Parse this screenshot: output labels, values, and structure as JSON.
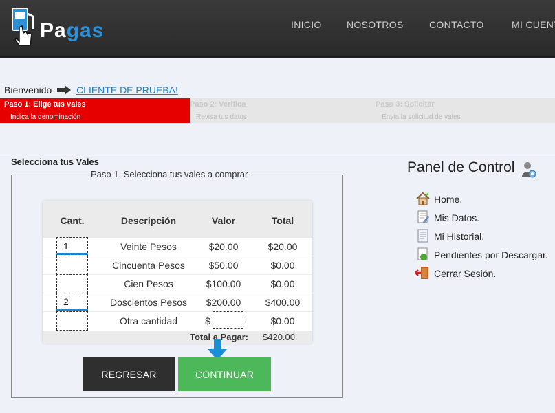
{
  "header": {
    "logo_text_a": "Pa",
    "logo_text_b": "gas",
    "nav": [
      "INICIO",
      "NOSOTROS",
      "CONTACTO",
      "MI CUENTA"
    ]
  },
  "welcome": {
    "label": "Bienvenido",
    "user": "CLIENTE DE PRUEBA!"
  },
  "steps": [
    {
      "title": "Paso 1: Elige tus vales",
      "subtitle": "Indica la denominación",
      "active": true
    },
    {
      "title": "Paso 2: Verifica",
      "subtitle": "Revisa tus datos",
      "active": false
    },
    {
      "title": "Paso 3: Solicitar",
      "subtitle": "Envia la solicitud de vales",
      "active": false
    }
  ],
  "form": {
    "section_title": "Selecciona tus Vales",
    "legend": "Paso 1. Selecciona tus vales a comprar",
    "columns": [
      "Cant.",
      "Descripción",
      "Valor",
      "Total"
    ],
    "rows": [
      {
        "qty": "1",
        "desc": "Veinte Pesos",
        "valor": "$20.00",
        "total": "$20.00"
      },
      {
        "qty": "",
        "desc": "Cincuenta Pesos",
        "valor": "$50.00",
        "total": "$0.00"
      },
      {
        "qty": "",
        "desc": "Cien Pesos",
        "valor": "$100.00",
        "total": "$0.00"
      },
      {
        "qty": "2",
        "desc": "Doscientos Pesos",
        "valor": "$200.00",
        "total": "$400.00"
      },
      {
        "qty": "",
        "desc": "Otra cantidad",
        "valor": "$",
        "total": "$0.00"
      }
    ],
    "total_label": "Total a Pagar:",
    "total_value": "$420.00",
    "back_label": "REGRESAR",
    "continue_label": "CONTINUAR"
  },
  "panel": {
    "title": "Panel de Control",
    "items": [
      "Home.",
      "Mis Datos.",
      "Mi Historial.",
      "Pendientes por Descargar.",
      "Cerrar Sesión."
    ],
    "icons": [
      "home-icon",
      "user-data-icon",
      "history-icon",
      "pending-download-icon",
      "logout-icon"
    ]
  },
  "colors": {
    "step_active": "#e60000",
    "continue_button": "#4cb85a",
    "back_button": "#2f2f2f",
    "link": "#1a80c8",
    "accent_underline": "#1a86d6"
  }
}
